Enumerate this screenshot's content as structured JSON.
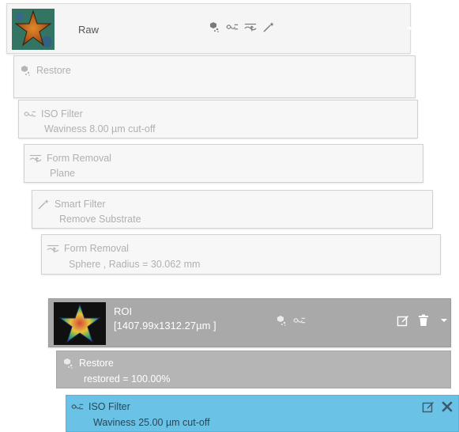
{
  "colors": {
    "card_bg": "#f7f7f7",
    "inactive_text": "#b0b0b0",
    "roi_bg": "#a9a9a9",
    "restore_active_bg": "#b5b5b5",
    "selected_bg": "#6ac2e6",
    "selected_text": "#2c4654"
  },
  "raw": {
    "title": "Raw",
    "thumbnail": "starfish-heightmap-thumbnail",
    "toolbar": [
      "restore-icon",
      "iso-filter-icon",
      "form-removal-icon",
      "smart-filter-icon"
    ],
    "menu": "chevron-down-icon"
  },
  "operators": [
    {
      "icon": "restore-icon",
      "name": "Restore",
      "detail": ""
    },
    {
      "icon": "iso-filter-icon",
      "name": "ISO Filter",
      "detail": "Waviness 8.00 µm cut-off"
    },
    {
      "icon": "form-removal-icon",
      "name": "Form Removal",
      "detail": "Plane"
    },
    {
      "icon": "smart-filter-icon",
      "name": "Smart Filter",
      "detail": "Remove Substrate"
    },
    {
      "icon": "form-removal-icon",
      "name": "Form Removal",
      "detail": "Sphere , Radius = 30.062 mm"
    }
  ],
  "roi": {
    "title": "ROI",
    "size": "[1407.99x1312.27µm ]",
    "thumbnail": "starfish-roi-thumbnail",
    "toolbar": [
      "restore-icon",
      "iso-filter-icon"
    ],
    "actions": [
      "edit-icon",
      "trash-icon",
      "chevron-down-icon"
    ]
  },
  "roi_operators": [
    {
      "icon": "restore-icon",
      "name": "Restore",
      "detail": "restored = 100.00%"
    },
    {
      "icon": "iso-filter-icon",
      "name": "ISO Filter",
      "detail": "Waviness 25.00 µm cut-off",
      "selected": true,
      "actions": [
        "edit-icon",
        "close-icon"
      ]
    }
  ]
}
